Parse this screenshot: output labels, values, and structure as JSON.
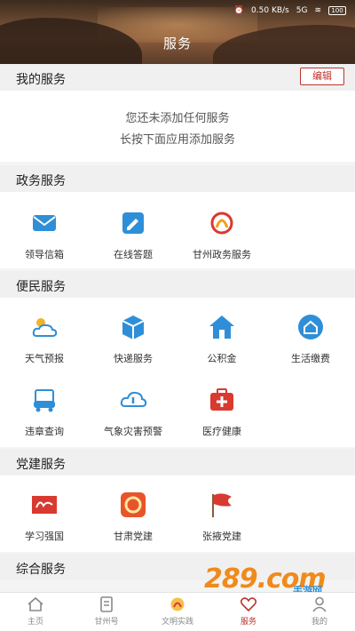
{
  "status_bar": {
    "speed": "0.50 KB/s",
    "network": "5G",
    "battery": "100"
  },
  "header": {
    "title": "服务"
  },
  "my_services": {
    "title": "我的服务",
    "edit_label": "编辑",
    "empty_line1": "您还未添加任何服务",
    "empty_line2": "长按下面应用添加服务"
  },
  "gov": {
    "title": "政务服务",
    "items": [
      {
        "label": "领导信箱",
        "icon": "mail-icon"
      },
      {
        "label": "在线答题",
        "icon": "edit-note-icon"
      },
      {
        "label": "甘州政务服务",
        "icon": "gov-logo-icon"
      }
    ]
  },
  "life": {
    "title": "便民服务",
    "items": [
      {
        "label": "天气预报",
        "icon": "weather-icon"
      },
      {
        "label": "快递服务",
        "icon": "package-icon"
      },
      {
        "label": "公积金",
        "icon": "house-fund-icon"
      },
      {
        "label": "生活缴费",
        "icon": "home-bill-icon"
      },
      {
        "label": "违章查询",
        "icon": "car-violation-icon"
      },
      {
        "label": "气象灾害预警",
        "icon": "cloud-warning-icon"
      },
      {
        "label": "医疗健康",
        "icon": "medical-kit-icon"
      }
    ]
  },
  "party": {
    "title": "党建服务",
    "items": [
      {
        "label": "学习强国",
        "icon": "xuexi-logo-icon"
      },
      {
        "label": "甘肃党建",
        "icon": "gansu-party-icon"
      },
      {
        "label": "张掖党建",
        "icon": "party-flag-icon"
      }
    ]
  },
  "general": {
    "title": "综合服务"
  },
  "tabs": [
    {
      "label": "主页",
      "icon": "home-icon"
    },
    {
      "label": "甘州号",
      "icon": "doc-icon"
    },
    {
      "label": "文明实践",
      "icon": "practice-logo-icon"
    },
    {
      "label": "服务",
      "icon": "heart-service-icon",
      "active": true
    },
    {
      "label": "我的",
      "icon": "profile-icon"
    }
  ],
  "watermark": {
    "logo": "289.com",
    "sub": "手游网"
  },
  "colors": {
    "accent": "#c0312b",
    "blue": "#2e8fd8",
    "red": "#d93a30"
  }
}
